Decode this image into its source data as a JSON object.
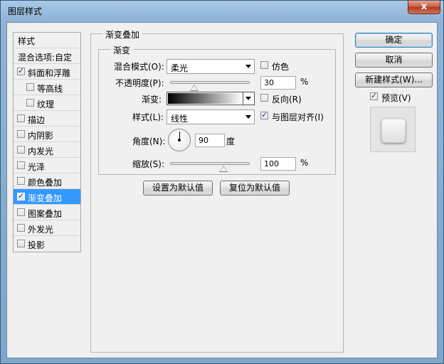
{
  "window": {
    "title": "图层样式",
    "close_label": "x"
  },
  "sidebar": {
    "header": "样式",
    "blend_options": "混合选项:自定",
    "items": [
      {
        "label": "斜面和浮雕",
        "checked": true,
        "indent": false
      },
      {
        "label": "等高线",
        "checked": false,
        "indent": true
      },
      {
        "label": "纹理",
        "checked": false,
        "indent": true
      },
      {
        "label": "描边",
        "checked": false,
        "indent": false
      },
      {
        "label": "内阴影",
        "checked": false,
        "indent": false
      },
      {
        "label": "内发光",
        "checked": false,
        "indent": false
      },
      {
        "label": "光泽",
        "checked": false,
        "indent": false
      },
      {
        "label": "颜色叠加",
        "checked": false,
        "indent": false
      },
      {
        "label": "渐变叠加",
        "checked": true,
        "indent": false,
        "selected": true
      },
      {
        "label": "图案叠加",
        "checked": false,
        "indent": false
      },
      {
        "label": "外发光",
        "checked": false,
        "indent": false
      },
      {
        "label": "投影",
        "checked": false,
        "indent": false
      }
    ]
  },
  "panel": {
    "outer_title": "渐变叠加",
    "inner_title": "渐变",
    "blend_mode": {
      "label": "混合模式(O):",
      "value": "柔光"
    },
    "dither": {
      "label": "仿色",
      "checked": false
    },
    "opacity": {
      "label": "不透明度(P):",
      "value": "30",
      "unit": "%",
      "level": 0.3
    },
    "gradient": {
      "label": "渐变:",
      "from_color": "#000000",
      "to_color": "#ffffff"
    },
    "reverse": {
      "label": "反向(R)",
      "checked": false
    },
    "style": {
      "label": "样式(L):",
      "value": "线性"
    },
    "align": {
      "label": "与图层对齐(I)",
      "checked": true
    },
    "angle": {
      "label": "角度(N):",
      "value": "90",
      "unit": "度"
    },
    "scale": {
      "label": "缩放(S):",
      "value": "100",
      "unit": "%",
      "level": 0.667
    },
    "make_default": "设置为默认值",
    "reset_default": "复位为默认值"
  },
  "actions": {
    "ok": "确定",
    "cancel": "取消",
    "new_style": "新建样式(W)...",
    "preview": {
      "label": "预览(V)",
      "checked": true
    }
  },
  "colors": {
    "selection": "#3399ff",
    "title_gradient_top": "#a9c8e6",
    "close_button": "#c7543c"
  }
}
